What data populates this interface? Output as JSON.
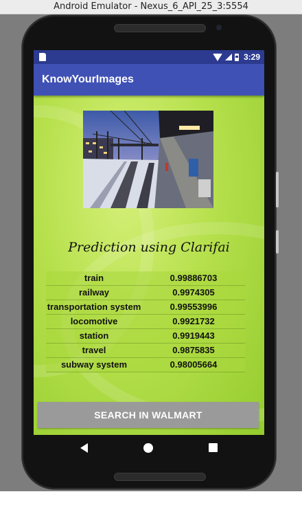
{
  "window": {
    "title": "Android Emulator - Nexus_6_API_25_3:5554"
  },
  "status_bar": {
    "time": "3:29"
  },
  "app": {
    "title": "KnowYourImages"
  },
  "heading": "Prediction using Clarifai",
  "predictions": [
    {
      "label": "train",
      "score": "0.99886703"
    },
    {
      "label": "railway",
      "score": "0.9974305"
    },
    {
      "label": "transportation system",
      "score": "0.99553996"
    },
    {
      "label": "locomotive",
      "score": "0.9921732"
    },
    {
      "label": "station",
      "score": "0.9919443"
    },
    {
      "label": "travel",
      "score": "0.9875835"
    },
    {
      "label": "subway system",
      "score": "0.98005664"
    }
  ],
  "walmart_button": {
    "label": "SEARCH IN WALMART"
  },
  "navigation": {
    "icons": [
      "back-icon",
      "home-icon",
      "recents-icon"
    ]
  },
  "colors": {
    "status_bar": "#2c3a8f",
    "app_bar": "#3f51b5",
    "button": "#9a9a9a"
  }
}
